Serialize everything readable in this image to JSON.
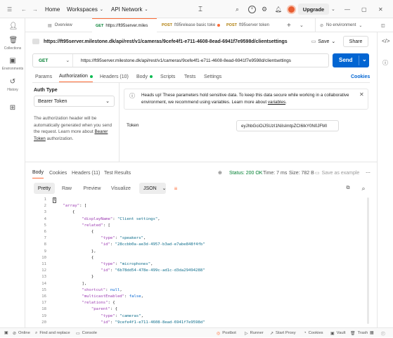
{
  "titlebar": {
    "home": "Home",
    "workspaces": "Workspaces",
    "api_network": "API Network",
    "upgrade": "Upgrade"
  },
  "sidebar": {
    "items": [
      {
        "label": "Collections",
        "icon": "collections-icon"
      },
      {
        "label": "Environments",
        "icon": "environments-icon"
      },
      {
        "label": "History",
        "icon": "history-icon"
      },
      {
        "label": "",
        "icon": "apps-icon"
      }
    ]
  },
  "tabs": [
    {
      "label": "Overview",
      "method": ""
    },
    {
      "label": "https://ft95server.miles",
      "method": "GET"
    },
    {
      "label": "ft95release basic toke",
      "method": "POST"
    },
    {
      "label": "ft95server token",
      "method": "POST"
    }
  ],
  "environment": "No environment",
  "request": {
    "title": "https://ft95server.milestone.dk/api/rest/v1/cameras/9cefe4f1-e711-4608-8ead-6941f7e9598d/clientsettings",
    "method": "GET",
    "url": "https://ft95server.milestone.dk/api/rest/v1/cameras/9cefe4f1-e711-4608-8ead-6941f7e9598d/clientsettings",
    "save": "Save",
    "share": "Share",
    "send": "Send",
    "tabs": [
      "Params",
      "Authorization",
      "Headers (10)",
      "Body",
      "Scripts",
      "Tests",
      "Settings"
    ],
    "cookies": "Cookies"
  },
  "auth": {
    "type_label": "Auth Type",
    "type_value": "Bearer Token",
    "description_1": "The authorization header will be automatically generated when you send the request. Learn more about",
    "description_link": "Bearer Token",
    "description_2": "authorization.",
    "alert_1": "Heads up! These parameters hold sensitive data. To keep this data secure while working in a collaborative environment, we recommend using variables. Learn more about",
    "alert_link": "variables",
    "token_label": "Token",
    "token_value": "eyJhbGciOiJSUzI1NiIsImtpZCI6IkY0N0JFMI"
  },
  "response": {
    "tabs": [
      "Body",
      "Cookies",
      "Headers (11)",
      "Test Results"
    ],
    "status": "Status: 200 OK",
    "time": "Time: 7 ms",
    "size": "Size: 782 B",
    "save_example": "Save as example",
    "view_tabs": [
      "Pretty",
      "Raw",
      "Preview",
      "Visualize"
    ],
    "format": "JSON"
  },
  "code_lines": [
    "{",
    "    \"array\": [",
    "        {",
    "            \"displayName\": \"Client settings\",",
    "            \"related\": [",
    "                {",
    "                    \"type\": \"speakers\",",
    "                    \"id\": \"28ccbb0a-ae3d-4957-b3ad-e7abe848f4fb\"",
    "                },",
    "                {",
    "                    \"type\": \"microphones\",",
    "                    \"id\": \"6b78dd54-478e-499c-ad1c-d3da29494288\"",
    "                }",
    "            ],",
    "            \"shortcut\": null,",
    "            \"multicastEnabled\": false,",
    "            \"relations\": {",
    "                \"parent\": {",
    "                    \"type\": \"cameras\",",
    "                    \"id\": \"9cefe4f1-e711-4608-8ead-6941f7e9598d\""
  ],
  "statusbar": {
    "online": "Online",
    "find": "Find and replace",
    "console": "Console",
    "postbot": "Postbot",
    "runner": "Runner",
    "proxy": "Start Proxy",
    "cookies": "Cookies",
    "vault": "Vault",
    "trash": "Trash"
  },
  "colors": {
    "accent": "#ff6c37",
    "send": "#0265d2",
    "get": "#007f31",
    "post": "#ad7a03"
  }
}
